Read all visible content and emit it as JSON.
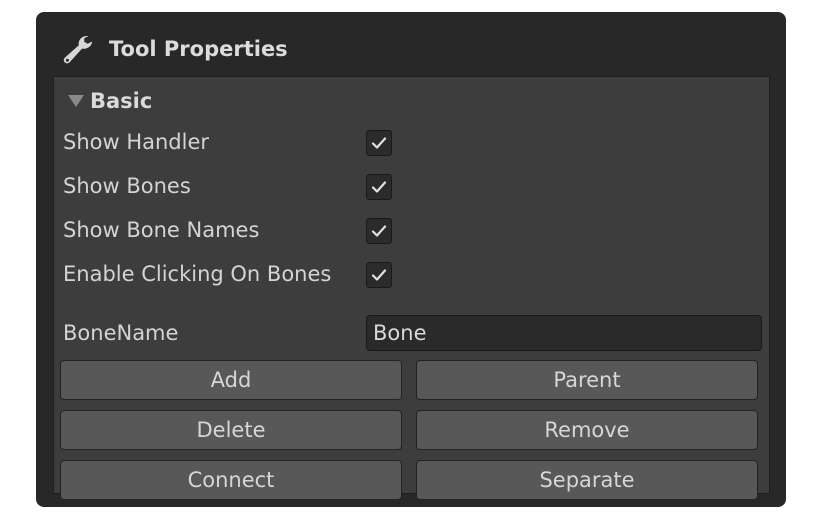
{
  "panel": {
    "title": "Tool Properties",
    "icon": "wrench-icon"
  },
  "section": {
    "label": "Basic",
    "expanded": true
  },
  "toggles": [
    {
      "label": "Show Handler",
      "checked": true
    },
    {
      "label": "Show Bones",
      "checked": true
    },
    {
      "label": "Show Bone Names",
      "checked": true
    },
    {
      "label": "Enable Clicking On Bones",
      "checked": true
    }
  ],
  "bone_name": {
    "label": "BoneName",
    "value": "Bone"
  },
  "buttons": {
    "add": "Add",
    "parent": "Parent",
    "delete": "Delete",
    "remove": "Remove",
    "connect": "Connect",
    "separate": "Separate"
  },
  "colors": {
    "panel_bg": "#282828",
    "content_bg": "#3d3d3d",
    "button_bg": "#585858",
    "field_bg": "#2a2a2a",
    "text": "#d4d4d4"
  }
}
